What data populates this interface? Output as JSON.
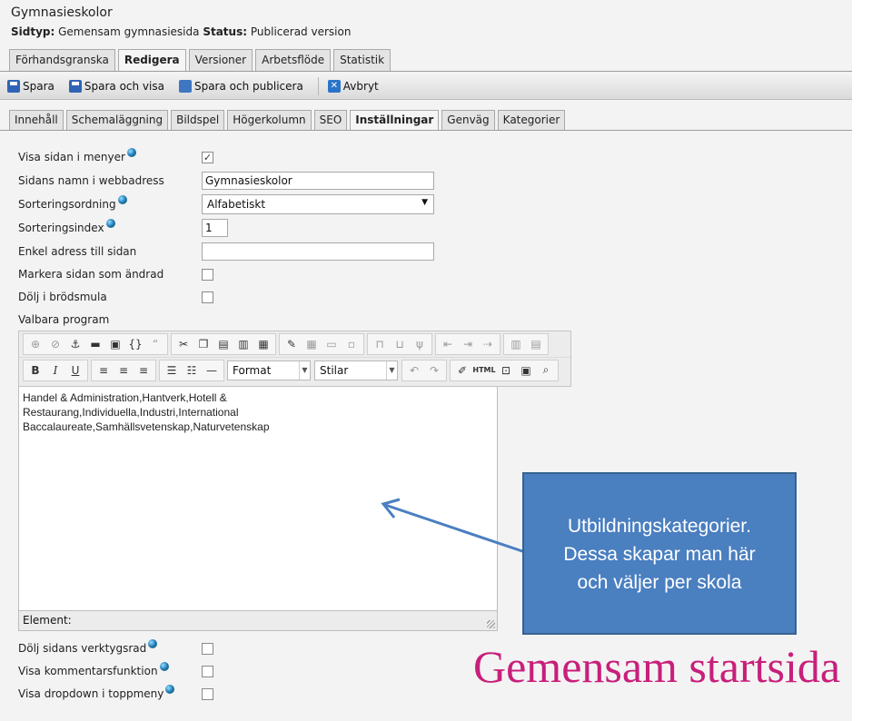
{
  "header": {
    "title": "Gymnasieskolor",
    "pagetype_label": "Sidtyp:",
    "pagetype_value": "Gemensam gymnasiesida",
    "status_label": "Status:",
    "status_value": "Publicerad version"
  },
  "top_tabs": [
    "Förhandsgranska",
    "Redigera",
    "Versioner",
    "Arbetsflöde",
    "Statistik"
  ],
  "top_tabs_active": "Redigera",
  "toolbar": {
    "save": "Spara",
    "save_view": "Spara och visa",
    "save_publish": "Spara och publicera",
    "cancel": "Avbryt"
  },
  "sub_tabs": [
    "Innehåll",
    "Schemaläggning",
    "Bildspel",
    "Högerkolumn",
    "SEO",
    "Inställningar",
    "Genväg",
    "Kategorier"
  ],
  "sub_tabs_active": "Inställningar",
  "form": {
    "show_in_menus": {
      "label": "Visa sidan i menyer",
      "checked": true
    },
    "url_name": {
      "label": "Sidans namn i webbadress",
      "value": "Gymnasieskolor"
    },
    "sort_order": {
      "label": "Sorteringsordning",
      "value": "Alfabetiskt"
    },
    "sort_index": {
      "label": "Sorteringsindex",
      "value": "1"
    },
    "simple_address": {
      "label": "Enkel adress till sidan",
      "value": ""
    },
    "mark_changed": {
      "label": "Markera sidan som ändrad",
      "checked": false
    },
    "hide_breadcrumb": {
      "label": "Dölj i brödsmula",
      "checked": false
    },
    "programs": {
      "label": "Valbara program",
      "content": "Handel & Administration,Hantverk,Hotell &\nRestaurang,Individuella,Industri,International\nBaccalaureate,Samhällsvetenskap,Naturvetenskap"
    },
    "hide_toolbar": {
      "label": "Dölj sidans verktygsrad",
      "checked": false
    },
    "show_comments": {
      "label": "Visa kommentarsfunktion",
      "checked": false
    },
    "show_dropdown": {
      "label": "Visa dropdown i toppmeny",
      "checked": false
    }
  },
  "editor": {
    "format_label": "Format",
    "styles_label": "Stilar",
    "html_label": "HTML",
    "status_label": "Element:"
  },
  "annotation": {
    "callout_text": "Utbildningskategorier.\nDessa skapar man här\noch väljer per skola",
    "caption": "Gemensam startsida"
  }
}
